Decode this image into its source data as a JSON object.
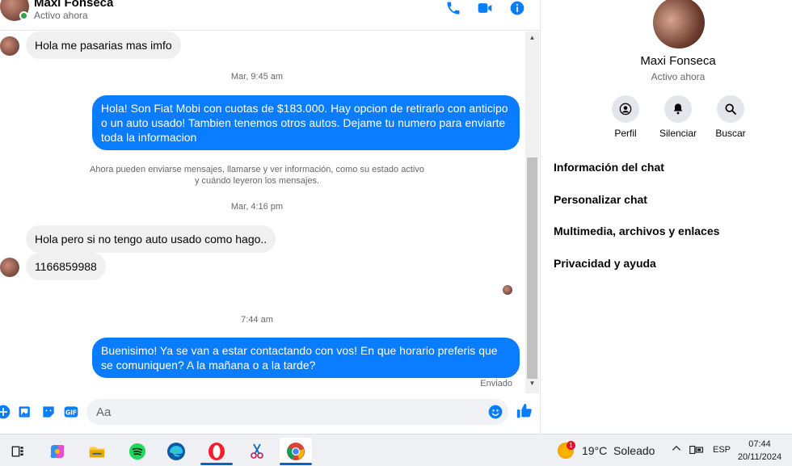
{
  "header": {
    "name": "Maxi Fonseca",
    "status": "Activo ahora"
  },
  "messages": {
    "m1": "Hola me pasarias mas imfo",
    "ts1": "Mar, 9:45 am",
    "m2": "Hola! Son Fiat Mobi con cuotas de $183.000. Hay opcion de retirarlo con anticipo o un auto usado! Tambien tenemos otros autos. Dejame tu numero para enviarte toda la informacion",
    "notice_line1": "Ahora pueden enviarse mensajes, llamarse y ver información, como su estado activo",
    "notice_line2": "y cuándo leyeron los mensajes.",
    "ts2": "Mar, 4:16 pm",
    "m3": "Hola pero si no tengo auto usado como hago..",
    "m4": "1166859988",
    "ts3": "7:44 am",
    "m5": "Buenisimo! Ya se van a estar contactando con vos! En que horario preferis que se comuniquen? A la mañana o a la tarde?",
    "sent_status": "Enviado"
  },
  "composer": {
    "placeholder": "Aa"
  },
  "side": {
    "name": "Maxi Fonseca",
    "status": "Activo ahora",
    "actions": [
      {
        "label": "Perfil",
        "icon": "profile-icon"
      },
      {
        "label": "Silenciar",
        "icon": "bell-icon"
      },
      {
        "label": "Buscar",
        "icon": "search-icon"
      }
    ],
    "items": [
      "Información del chat",
      "Personalizar chat",
      "Multimedia, archivos y enlaces",
      "Privacidad y ayuda"
    ]
  },
  "taskbar": {
    "weather_badge": "1",
    "weather": "19°C  Soleado",
    "lang": "ESP",
    "time": "07:44",
    "date": "20/11/2024"
  },
  "colors": {
    "accent": "#0a7cff",
    "incoming_bubble": "#f0f0f0",
    "online": "#31a24c"
  }
}
